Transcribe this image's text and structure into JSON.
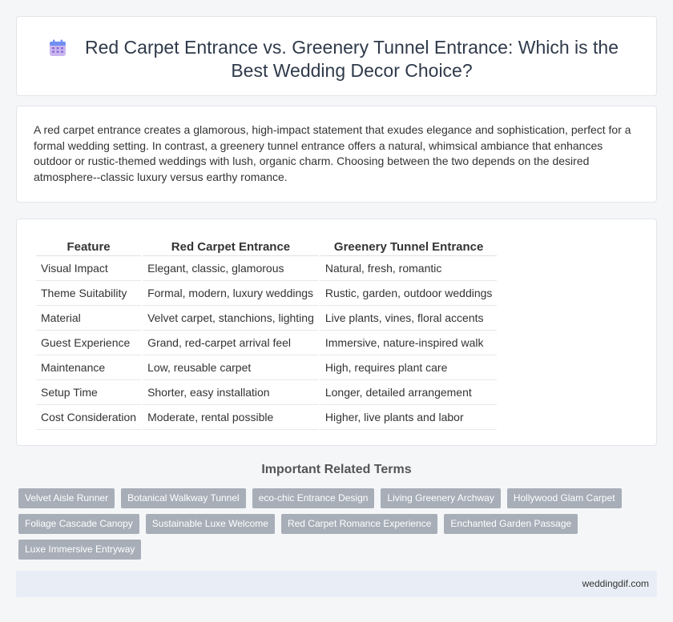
{
  "header": {
    "title": "Red Carpet Entrance vs. Greenery Tunnel Entrance: Which is the Best Wedding Decor Choice?",
    "icon": "calendar-icon"
  },
  "intro": {
    "text": "A red carpet entrance creates a glamorous, high-impact statement that exudes elegance and sophistication, perfect for a formal wedding setting. In contrast, a greenery tunnel entrance offers a natural, whimsical ambiance that enhances outdoor or rustic-themed weddings with lush, organic charm. Choosing between the two depends on the desired atmosphere--classic luxury versus earthy romance."
  },
  "table": {
    "headers": [
      "Feature",
      "Red Carpet Entrance",
      "Greenery Tunnel Entrance"
    ],
    "rows": [
      [
        "Visual Impact",
        "Elegant, classic, glamorous",
        "Natural, fresh, romantic"
      ],
      [
        "Theme Suitability",
        "Formal, modern, luxury weddings",
        "Rustic, garden, outdoor weddings"
      ],
      [
        "Material",
        "Velvet carpet, stanchions, lighting",
        "Live plants, vines, floral accents"
      ],
      [
        "Guest Experience",
        "Grand, red-carpet arrival feel",
        "Immersive, nature-inspired walk"
      ],
      [
        "Maintenance",
        "Low, reusable carpet",
        "High, requires plant care"
      ],
      [
        "Setup Time",
        "Shorter, easy installation",
        "Longer, detailed arrangement"
      ],
      [
        "Cost Consideration",
        "Moderate, rental possible",
        "Higher, live plants and labor"
      ]
    ]
  },
  "related": {
    "title": "Important Related Terms",
    "tags": [
      "Velvet Aisle Runner",
      "Botanical Walkway Tunnel",
      "eco-chic Entrance Design",
      "Living Greenery Archway",
      "Hollywood Glam Carpet",
      "Foliage Cascade Canopy",
      "Sustainable Luxe Welcome",
      "Red Carpet Romance Experience",
      "Enchanted Garden Passage",
      "Luxe Immersive Entryway"
    ]
  },
  "footer": {
    "site": "weddingdif.com"
  },
  "colors": {
    "tag_bg": "#a7aeb8",
    "footer_bg": "#e9eef6",
    "title": "#2f3a4a"
  }
}
